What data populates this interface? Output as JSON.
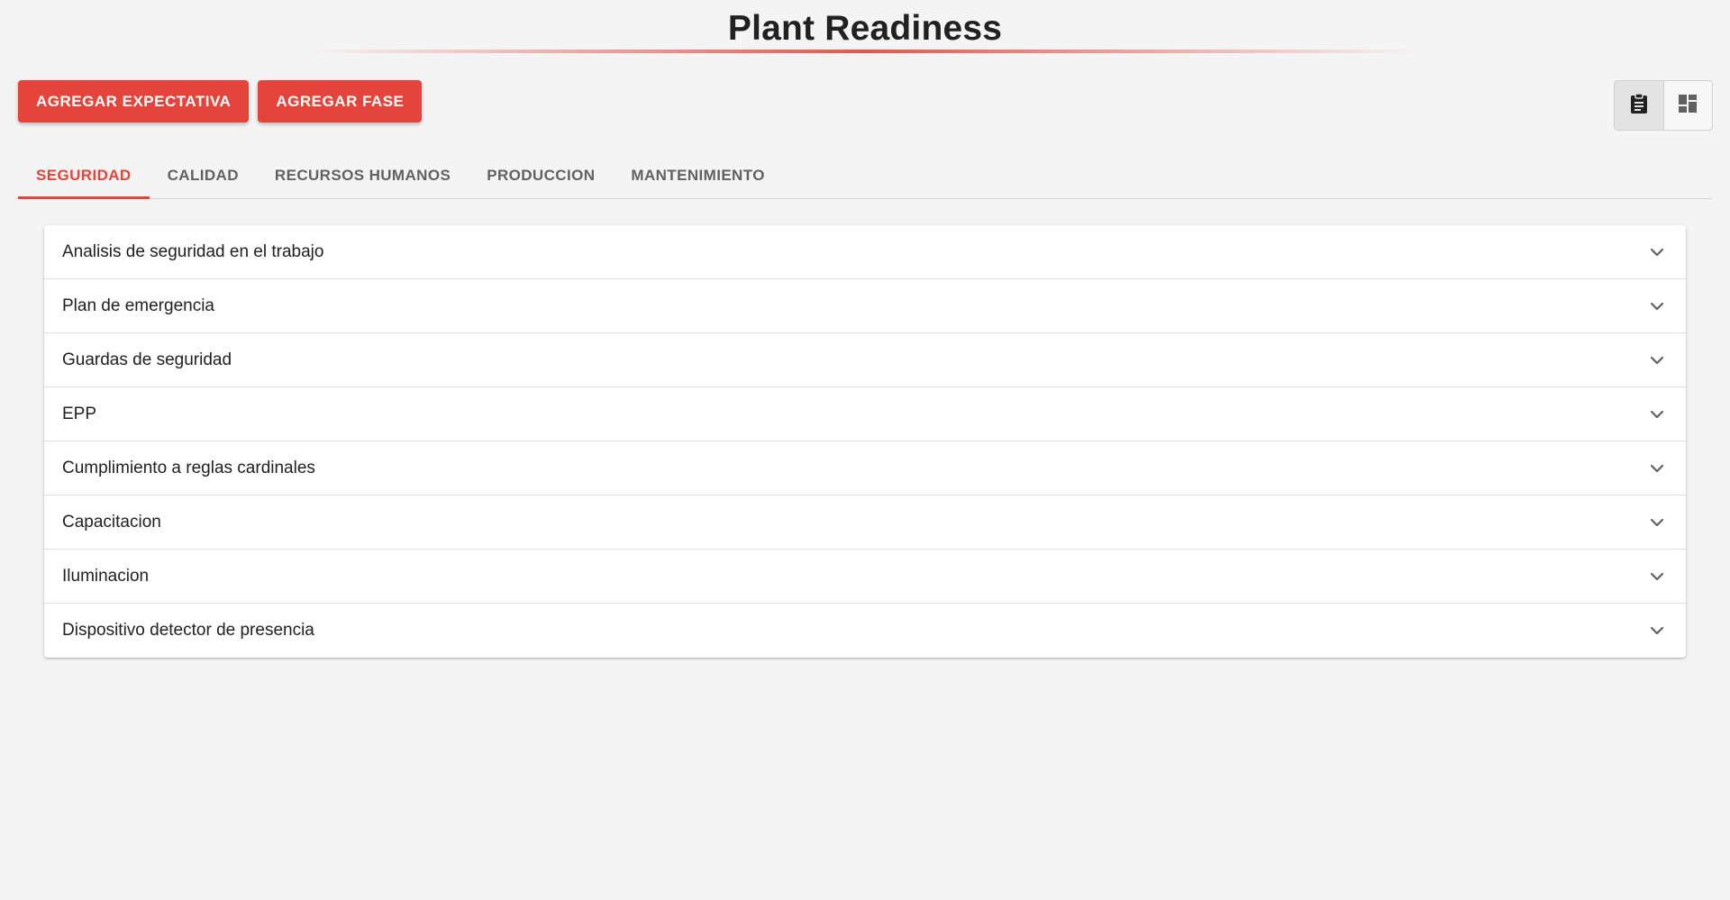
{
  "header": {
    "title": "Plant Readiness"
  },
  "actions": {
    "add_expectation_label": "AGREGAR EXPECTATIVA",
    "add_phase_label": "AGREGAR FASE"
  },
  "view_toggle": {
    "options": [
      {
        "icon": "clipboard-icon",
        "active": true
      },
      {
        "icon": "dashboard-icon",
        "active": false
      }
    ]
  },
  "tabs": [
    {
      "label": "SEGURIDAD",
      "active": true
    },
    {
      "label": "CALIDAD",
      "active": false
    },
    {
      "label": "RECURSOS HUMANOS",
      "active": false
    },
    {
      "label": "PRODUCCION",
      "active": false
    },
    {
      "label": "MANTENIMIENTO",
      "active": false
    }
  ],
  "accordion": {
    "items": [
      {
        "label": "Analisis de seguridad en el trabajo"
      },
      {
        "label": "Plan de emergencia"
      },
      {
        "label": "Guardas de seguridad"
      },
      {
        "label": "EPP"
      },
      {
        "label": "Cumplimiento a reglas cardinales"
      },
      {
        "label": "Capacitacion"
      },
      {
        "label": "Iluminacion"
      },
      {
        "label": "Dispositivo detector de presencia"
      }
    ]
  },
  "colors": {
    "accent": "#e5443a",
    "background": "#f4f4f4",
    "text": "#212121",
    "tab_inactive": "#616161"
  }
}
